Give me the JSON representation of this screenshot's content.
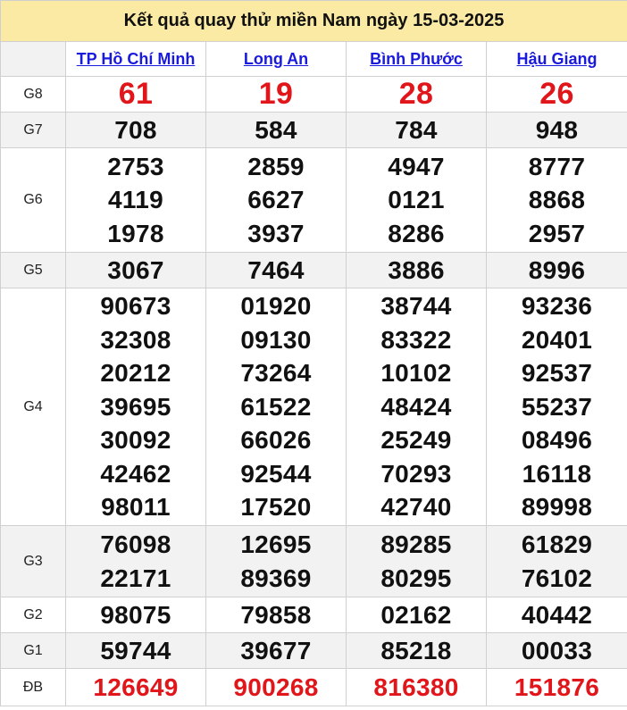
{
  "title": "Kết quả quay thử miền Nam ngày 15-03-2025",
  "provinces": [
    "TP Hồ Chí Minh",
    "Long An",
    "Bình Phước",
    "Hậu Giang"
  ],
  "prizes": [
    {
      "label": "G8",
      "values": [
        [
          "61"
        ],
        [
          "19"
        ],
        [
          "28"
        ],
        [
          "26"
        ]
      ],
      "red": true
    },
    {
      "label": "G7",
      "values": [
        [
          "708"
        ],
        [
          "584"
        ],
        [
          "784"
        ],
        [
          "948"
        ]
      ]
    },
    {
      "label": "G6",
      "values": [
        [
          "2753",
          "4119",
          "1978"
        ],
        [
          "2859",
          "6627",
          "3937"
        ],
        [
          "4947",
          "0121",
          "8286"
        ],
        [
          "8777",
          "8868",
          "2957"
        ]
      ]
    },
    {
      "label": "G5",
      "values": [
        [
          "3067"
        ],
        [
          "7464"
        ],
        [
          "3886"
        ],
        [
          "8996"
        ]
      ]
    },
    {
      "label": "G4",
      "values": [
        [
          "90673",
          "32308",
          "20212",
          "39695",
          "30092",
          "42462",
          "98011"
        ],
        [
          "01920",
          "09130",
          "73264",
          "61522",
          "66026",
          "92544",
          "17520"
        ],
        [
          "38744",
          "83322",
          "10102",
          "48424",
          "25249",
          "70293",
          "42740"
        ],
        [
          "93236",
          "20401",
          "92537",
          "55237",
          "08496",
          "16118",
          "89998"
        ]
      ]
    },
    {
      "label": "G3",
      "values": [
        [
          "76098",
          "22171"
        ],
        [
          "12695",
          "89369"
        ],
        [
          "89285",
          "80295"
        ],
        [
          "61829",
          "76102"
        ]
      ]
    },
    {
      "label": "G2",
      "values": [
        [
          "98075"
        ],
        [
          "79858"
        ],
        [
          "02162"
        ],
        [
          "40442"
        ]
      ]
    },
    {
      "label": "G1",
      "values": [
        [
          "59744"
        ],
        [
          "39677"
        ],
        [
          "85218"
        ],
        [
          "00033"
        ]
      ]
    },
    {
      "label": "ĐB",
      "values": [
        [
          "126649"
        ],
        [
          "900268"
        ],
        [
          "816380"
        ],
        [
          "151876"
        ]
      ],
      "red": true
    }
  ],
  "colors": {
    "title_bg": "#fbeaa4",
    "link": "#1a1adc",
    "red": "#e0161b",
    "alt_row": "#f2f2f2"
  }
}
